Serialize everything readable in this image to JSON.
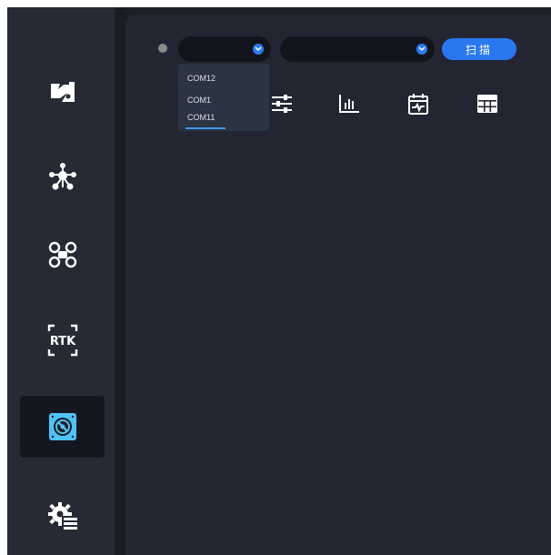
{
  "sidebar": {
    "items": [
      {
        "name": "image-icon",
        "active": false
      },
      {
        "name": "network-icon",
        "active": false
      },
      {
        "name": "drone-icon",
        "active": false
      },
      {
        "name": "rtk-icon",
        "label": "RTK",
        "active": false
      },
      {
        "name": "disk-icon",
        "active": true
      },
      {
        "name": "gear-list-icon",
        "active": false
      }
    ]
  },
  "toolbar": {
    "port_value": "",
    "baud_value": "",
    "scan_label": "扫描",
    "tools": [
      "chip-icon",
      "sliders-icon",
      "bar-chart-icon",
      "calendar-wave-icon",
      "table-icon"
    ]
  },
  "dropdown": {
    "options": [
      "COM12",
      "COM1",
      "COM11"
    ]
  },
  "colors": {
    "accent": "#2a78f0",
    "active_icon": "#4fc3f7",
    "icon": "#ffffff"
  }
}
